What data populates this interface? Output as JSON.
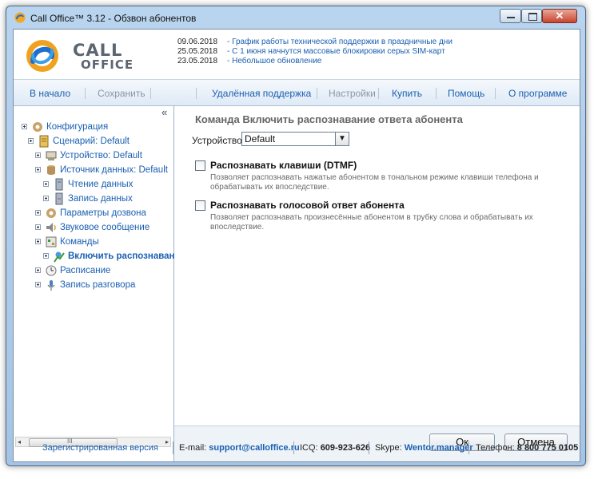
{
  "window": {
    "title": "Call Office™ 3.12 - Обзвон абонентов",
    "close_glyph": "✕"
  },
  "header": {
    "logo_line1": "CALL",
    "logo_line2": "OFFICE",
    "news": [
      {
        "date": "09.06.2018",
        "text": "- График работы технической поддержки в праздничные дни"
      },
      {
        "date": "25.05.2018",
        "text": "- С 1 июня начнутся массовые блокировки серых SIM-карт"
      },
      {
        "date": "23.05.2018",
        "text": "- Небольшое обновление"
      }
    ]
  },
  "menu": {
    "home": "В начало",
    "save": "Сохранить",
    "remote": "Удалённая поддержка",
    "settings": "Настройки",
    "buy": "Купить",
    "help": "Помощь",
    "about": "О программе"
  },
  "tree": {
    "collapse_glyph": "«",
    "items": [
      {
        "label": "Конфигурация"
      },
      {
        "label": "Сценарий: Default"
      },
      {
        "label": "Устройство: Default"
      },
      {
        "label": "Источник данных: Default"
      },
      {
        "label": "Чтение данных"
      },
      {
        "label": "Запись данных"
      },
      {
        "label": "Параметры дозвона"
      },
      {
        "label": "Звуковое сообщение"
      },
      {
        "label": "Команды"
      },
      {
        "label": "Включить распознавание"
      },
      {
        "label": "Расписание"
      },
      {
        "label": "Запись разговора"
      }
    ],
    "scroll_left": "◂",
    "scroll_right": "▸",
    "scroll_grip": "III"
  },
  "content": {
    "title": "Команда Включить распознавание ответа абонента",
    "device_label": "Устройство:",
    "device_value": "Default",
    "options": [
      {
        "label": "Распознавать клавиши (DTMF)",
        "desc": "Позволяет распознавать нажатые абонентом в тональном режиме клавиши телефона и обрабатывать их впоследствие.",
        "checked": false
      },
      {
        "label": "Распознавать голосовой ответ абонента",
        "desc": "Позволяет распознавать произнесённые абонентом в трубку слова и обрабатывать их впоследствие.",
        "checked": false
      }
    ],
    "ok": "Ок",
    "cancel": "Отмена"
  },
  "status": {
    "registered": "Зарегистрированная версия",
    "email_label": "E-mail:",
    "email": "support@calloffice.ru",
    "icq_label": "ICQ:",
    "icq": "609-923-626",
    "skype_label": "Skype:",
    "skype": "Wentor.manager",
    "phone_label": "Телефон:",
    "phone": "8 800 775 0105"
  }
}
